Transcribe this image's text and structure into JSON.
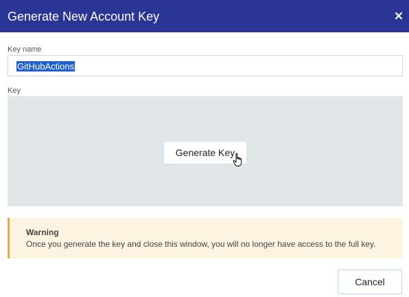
{
  "dialog": {
    "title": "Generate New Account Key",
    "close_icon": "close-icon"
  },
  "key_name": {
    "label": "Key name",
    "value": "GitHubActions",
    "selected": true
  },
  "key": {
    "label": "Key",
    "generate_label": "Generate Key"
  },
  "warning": {
    "title": "Warning",
    "message": "Once you generate the key and close this window, you will no longer have access to the full key."
  },
  "footer": {
    "cancel_label": "Cancel"
  },
  "colors": {
    "header_bg": "#2b3594",
    "selection_bg": "#1e5fd6",
    "keybox_bg": "#e1e6e9",
    "warning_bg": "#fdf3e1",
    "warning_accent": "#f5a623"
  }
}
